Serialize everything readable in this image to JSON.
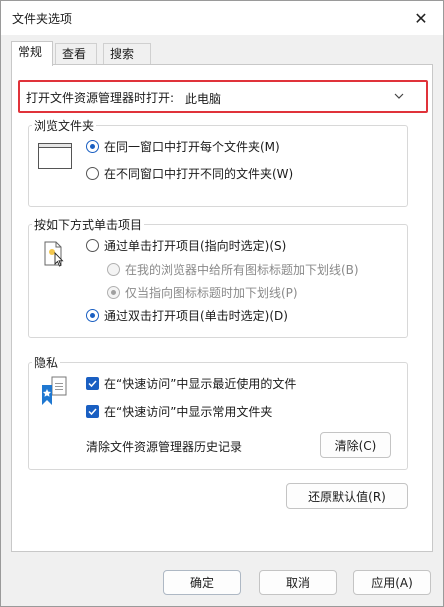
{
  "window": {
    "title": "文件夹选项",
    "close_glyph": "✕"
  },
  "tabs": [
    {
      "label": "常规",
      "active": true
    },
    {
      "label": "查看",
      "active": false
    },
    {
      "label": "搜索",
      "active": false
    }
  ],
  "general": {
    "open_label": "打开文件资源管理器时打开:",
    "open_value": "此电脑",
    "browse": {
      "title": "浏览文件夹",
      "option_same": "在同一窗口中打开每个文件夹(M)",
      "option_new": "在不同窗口中打开不同的文件夹(W)",
      "selected": "same"
    },
    "click": {
      "title": "按如下方式单击项目",
      "option_single": "通过单击打开项目(指向时选定)(S)",
      "sub_all": "在我的浏览器中给所有图标标题加下划线(B)",
      "sub_point": "仅当指向图标标题时加下划线(P)",
      "option_double": "通过双击打开项目(单击时选定)(D)",
      "selected": "double"
    },
    "privacy": {
      "title": "隐私",
      "show_recent": "在“快速访问”中显示最近使用的文件",
      "show_frequent": "在“快速访问”中显示常用文件夹",
      "clear_label": "清除文件资源管理器历史记录",
      "clear_button": "清除(C)"
    },
    "restore_button": "还原默认值(R)"
  },
  "footer": {
    "ok": "确定",
    "cancel": "取消",
    "apply": "应用(A)"
  },
  "colors": {
    "accent": "#1a5fc2",
    "highlight_box": "#e0333a"
  }
}
